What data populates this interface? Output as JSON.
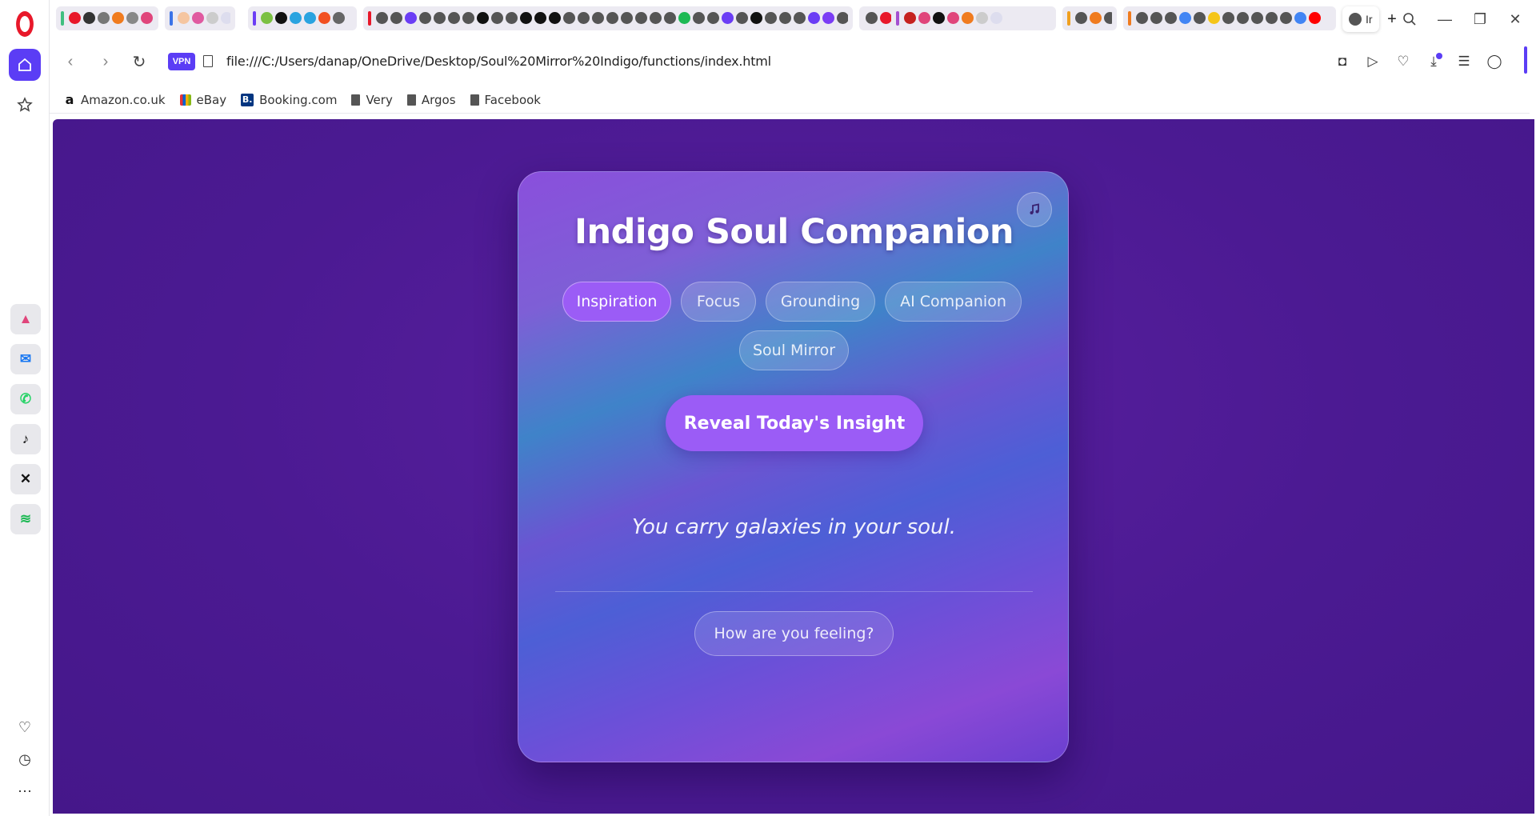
{
  "browser": {
    "active_tab_title": "Ir",
    "vpn_label": "VPN",
    "url": "file:///C:/Users/danap/OneDrive/Desktop/Soul%20Mirror%20Indigo/functions/index.html",
    "accent_color": "#5b3df5"
  },
  "bookmarks": [
    {
      "label": "Amazon.co.uk",
      "icon": "amazon-icon"
    },
    {
      "label": "eBay",
      "icon": "ebay-icon"
    },
    {
      "label": "Booking.com",
      "icon": "booking-icon"
    },
    {
      "label": "Very",
      "icon": "document-icon"
    },
    {
      "label": "Argos",
      "icon": "document-icon"
    },
    {
      "label": "Facebook",
      "icon": "document-icon"
    }
  ],
  "sidebar": {
    "apps": [
      "aria-icon",
      "messenger-icon",
      "whatsapp-icon",
      "tiktok-icon",
      "x-icon",
      "spotify-icon"
    ]
  },
  "app": {
    "title": "Indigo Soul Companion",
    "tabs": [
      {
        "label": "Inspiration",
        "active": true
      },
      {
        "label": "Focus",
        "active": false
      },
      {
        "label": "Grounding",
        "active": false
      },
      {
        "label": "AI Companion",
        "active": false
      },
      {
        "label": "Soul Mirror",
        "active": false
      }
    ],
    "reveal_button": "Reveal Today's Insight",
    "insight": "You carry galaxies in your soul.",
    "feeling_button": "How are you feeling?",
    "music_icon": "music-note-icon",
    "button_color": "#9b5cf6",
    "background_color": "#4b1a92"
  }
}
